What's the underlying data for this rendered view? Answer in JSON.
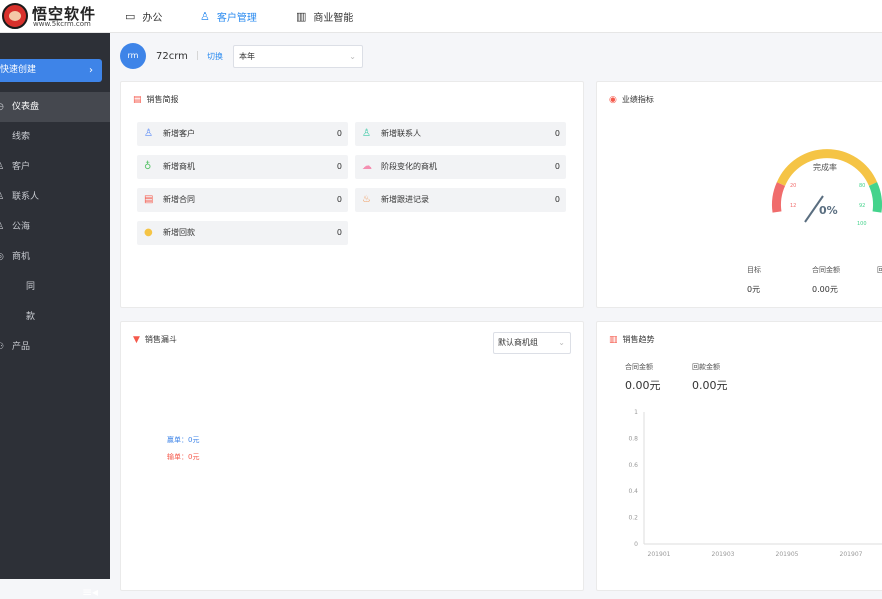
{
  "brand": {
    "name": "悟空软件",
    "url": "www.5kcrm.com"
  },
  "topnav": [
    {
      "icon": "monitor-icon",
      "label": "办公"
    },
    {
      "icon": "customer-icon",
      "label": "客户管理"
    },
    {
      "icon": "bar-chart-icon",
      "label": "商业智能"
    }
  ],
  "sidebar": {
    "quick_create": "快速创建",
    "items": [
      {
        "label": "仪表盘"
      },
      {
        "label": "线索"
      },
      {
        "label": "客户"
      },
      {
        "label": "联系人"
      },
      {
        "label": "公海"
      },
      {
        "label": "商机"
      },
      {
        "label": "同"
      },
      {
        "label": "款"
      },
      {
        "label": "产品"
      }
    ]
  },
  "userbar": {
    "avatar": "rm",
    "name": "72crm",
    "switch": "切换",
    "period": "本年"
  },
  "brief": {
    "title": "销售简报",
    "items": [
      {
        "label": "新增客户",
        "value": "0"
      },
      {
        "label": "新增联系人",
        "value": "0"
      },
      {
        "label": "新增商机",
        "value": "0"
      },
      {
        "label": "阶段变化的商机",
        "value": "0"
      },
      {
        "label": "新增合同",
        "value": "0"
      },
      {
        "label": "新增跟进记录",
        "value": "0"
      },
      {
        "label": "新增回款",
        "value": "0"
      }
    ]
  },
  "performance": {
    "title": "业绩指标",
    "gauge_label": "完成率",
    "gauge_value": "0%",
    "gauge_ticks": [
      "20",
      "12",
      "80",
      "92",
      "100"
    ],
    "stats": [
      {
        "label": "目标",
        "value": "0元"
      },
      {
        "label": "合同金额",
        "value": "0.00元"
      },
      {
        "label": "回",
        "value": ""
      }
    ]
  },
  "funnel": {
    "title": "销售漏斗",
    "select": "默认商机组",
    "win_label": "赢单：0元",
    "lose_label": "输单：0元"
  },
  "trend": {
    "title": "销售趋势",
    "stats": [
      {
        "label": "合同金额",
        "value": "0.00元"
      },
      {
        "label": "回款金额",
        "value": "0.00元"
      }
    ]
  },
  "chart_data": {
    "type": "line",
    "x": [
      "201901",
      "201903",
      "201905",
      "201907"
    ],
    "series": [
      {
        "values": [
          0,
          0,
          0,
          0
        ]
      }
    ],
    "yticks": [
      "0",
      "0.2",
      "0.4",
      "0.6",
      "0.8",
      "1"
    ],
    "ylim": [
      0,
      1
    ]
  },
  "colors": {
    "primary": "#3e84e8",
    "sidebar": "#2d3037",
    "win": "#3e84e8",
    "lose": "#f5594b"
  }
}
